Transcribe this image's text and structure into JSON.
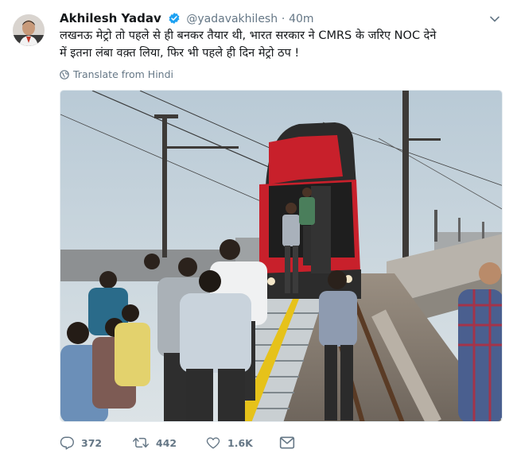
{
  "tweet": {
    "author_name": "Akhilesh Yadav",
    "verified": true,
    "handle": "@yadavakhilesh",
    "separator": "·",
    "time": "40m",
    "text": "लखनऊ मेट्रो तो पहले से ही बनकर तैयार थी, भारत सरकार ने CMRS के जरिए NOC देने\nमें इतना लंबा वक़्त लिया, फिर भी पहले ही दिन मेट्रो ठप !",
    "translate_label": "Translate from Hindi",
    "photo_description": "passengers-exiting-stalled-metro-train",
    "stats": {
      "replies": "372",
      "retweets": "442",
      "likes": "1.6K"
    }
  },
  "colors": {
    "text_primary": "#14171a",
    "text_secondary": "#657786",
    "verified_blue": "#1da1f2",
    "train_red": "#c8202b"
  },
  "icons": [
    "verified-badge-icon",
    "chevron-down-icon",
    "globe-icon",
    "reply-icon",
    "retweet-icon",
    "heart-icon",
    "envelope-icon"
  ]
}
